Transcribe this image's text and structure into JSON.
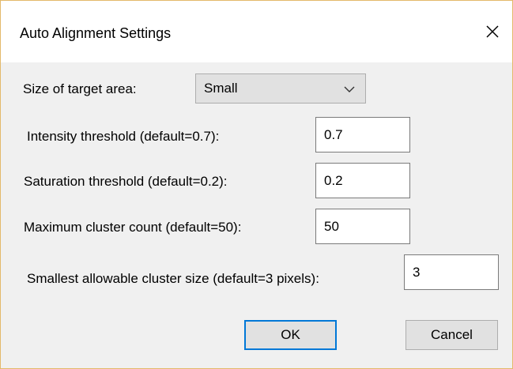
{
  "dialog": {
    "title": "Auto Alignment Settings",
    "close_icon": "close-icon"
  },
  "target_area": {
    "label": "Size of target area:",
    "selected": "Small",
    "icon": "chevron-down-icon"
  },
  "fields": [
    {
      "label": "Intensity threshold (default=0.7):",
      "value": "0.7"
    },
    {
      "label": "Saturation threshold (default=0.2):",
      "value": "0.2"
    },
    {
      "label": "Maximum cluster count (default=50):",
      "value": "50"
    },
    {
      "label": "Smallest allowable cluster size (default=3 pixels):",
      "value": "3"
    }
  ],
  "buttons": {
    "ok": "OK",
    "cancel": "Cancel"
  },
  "colors": {
    "window_border": "#e3b96a",
    "accent": "#0078d7",
    "title_bg": "#ffffff",
    "body_bg": "#f0f0f0"
  }
}
